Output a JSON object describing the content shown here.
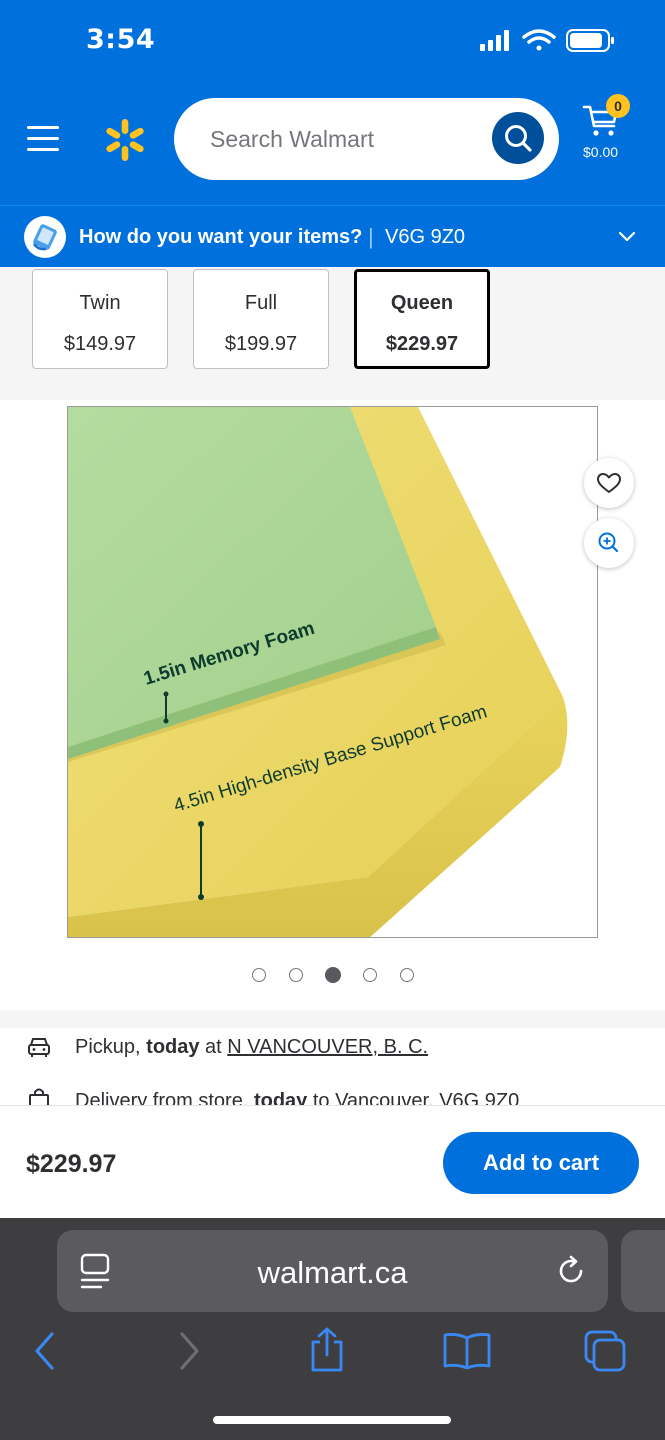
{
  "status_bar": {
    "time": "3:54"
  },
  "header": {
    "search": {
      "placeholder": "Search Walmart"
    },
    "cart": {
      "count": "0",
      "total": "$0.00"
    }
  },
  "pickup_prompt": {
    "question": "How do you want your items?",
    "separator": "|",
    "postal_code": "V6G 9Z0"
  },
  "size_options": [
    {
      "size": "Twin",
      "price": "$149.97",
      "selected": false
    },
    {
      "size": "Full",
      "price": "$199.97",
      "selected": false
    },
    {
      "size": "Queen",
      "price": "$229.97",
      "selected": true
    }
  ],
  "product_image": {
    "label_top": "1.5in Memory Foam",
    "label_bottom": "4.5in High-density Base Support Foam",
    "carousel_count": 5,
    "carousel_active": 3
  },
  "fulfillment": {
    "pickup": {
      "prefix": "Pickup, ",
      "when": "today",
      "at": " at ",
      "store": "N VANCOUVER, B. C."
    },
    "delivery": {
      "prefix": "Delivery from store, ",
      "when": "today",
      "to": " to Vancouver, V6G 9Z0"
    }
  },
  "sticky_bar": {
    "price": "$229.97",
    "add_to_cart": "Add to cart"
  },
  "browser": {
    "url": "walmart.ca"
  },
  "colors": {
    "brand_blue": "#0071dc",
    "spark_yellow": "#ffc220",
    "dark_blue": "#004f9a"
  }
}
